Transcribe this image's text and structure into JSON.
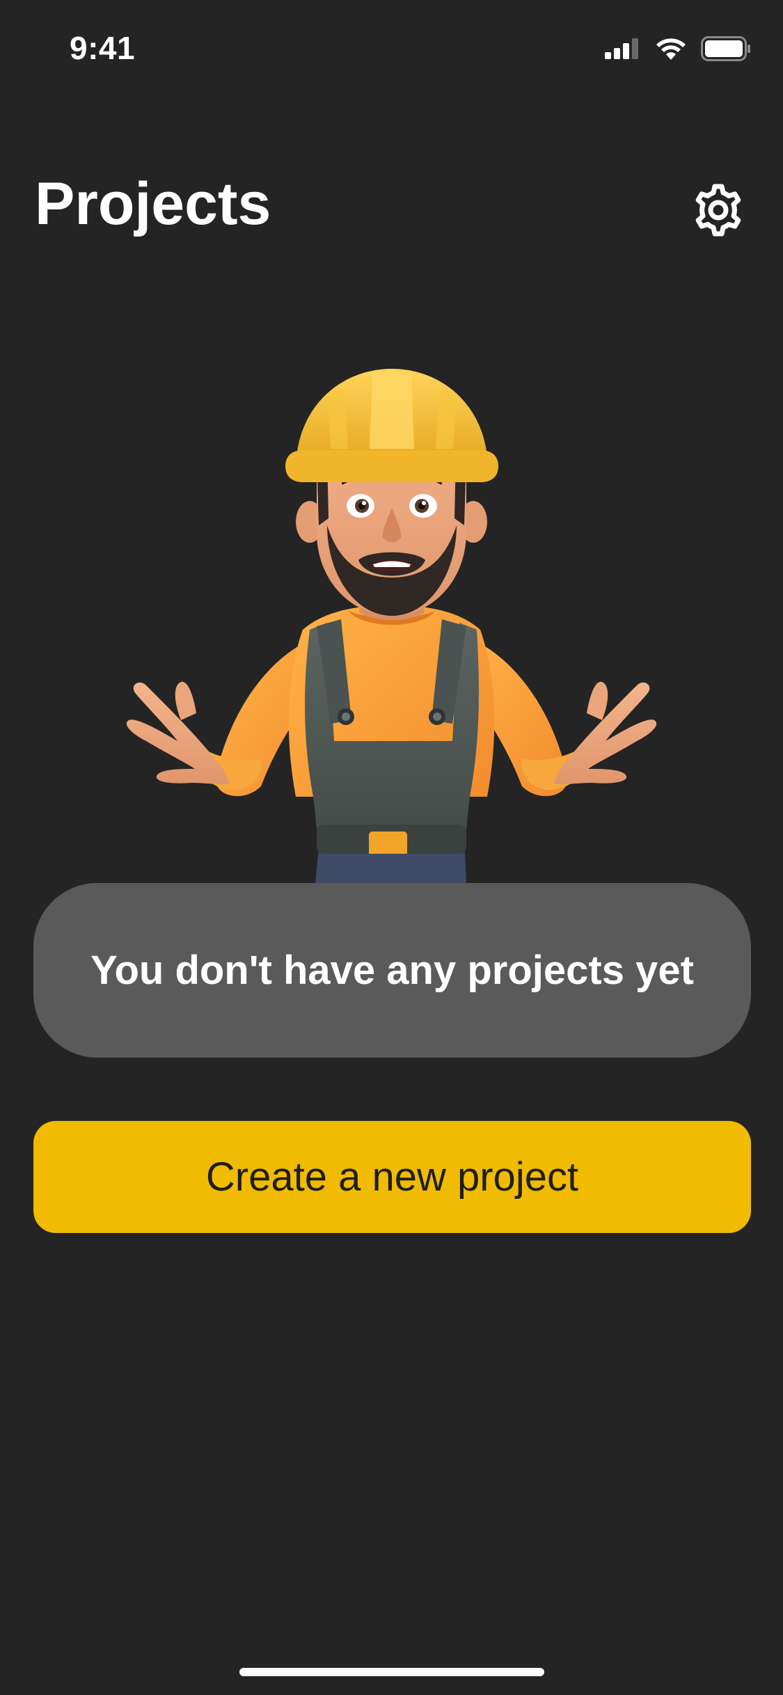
{
  "status_bar": {
    "time": "9:41",
    "icons": [
      "cellular-signal-icon",
      "wifi-icon",
      "battery-icon"
    ]
  },
  "header": {
    "title": "Projects",
    "settings_icon": "gear-icon"
  },
  "empty_state": {
    "illustration": "construction-worker-shrug-illustration",
    "message": "You don't have any projects yet"
  },
  "actions": {
    "create_label": "Create a new project"
  },
  "colors": {
    "background": "#242424",
    "card": "#5a5a5a",
    "accent": "#f0bb00",
    "text_primary": "#ffffff",
    "button_text": "#1f1f1f"
  }
}
